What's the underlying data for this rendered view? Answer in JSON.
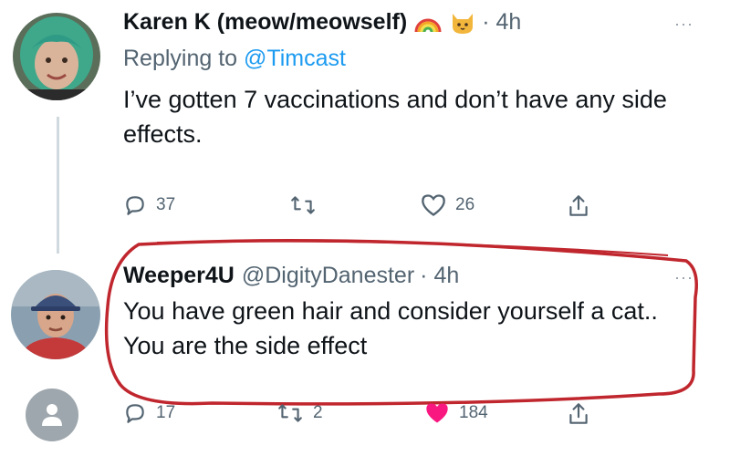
{
  "tweet1": {
    "name": "Karen K (meow/meowself)",
    "time": "· 4h",
    "more": "···",
    "reply_prefix": "Replying to ",
    "reply_handle": "@Timcast",
    "text": "I’ve gotten 7 vaccinations and don’t have any side effects.",
    "replies": "37",
    "likes": "26",
    "icons": [
      "rainbow-emoji",
      "cat-emoji",
      "reply-icon",
      "retweet-icon",
      "heart-icon",
      "share-icon"
    ]
  },
  "tweet2": {
    "name": "Weeper4U",
    "handle": "@DigityDanester",
    "time": "· 4h",
    "more": "···",
    "text": "You have green hair and consider yourself a cat.. You are the side effect",
    "replies": "17",
    "retweets": "2",
    "likes": "184",
    "icons": [
      "reply-icon",
      "retweet-icon",
      "heart-filled-icon",
      "share-icon"
    ]
  },
  "colors": {
    "text": "#0f1419",
    "muted": "#536471",
    "link": "#1d9bf0",
    "like_active": "#f91880",
    "annotation": "#c0262d"
  }
}
